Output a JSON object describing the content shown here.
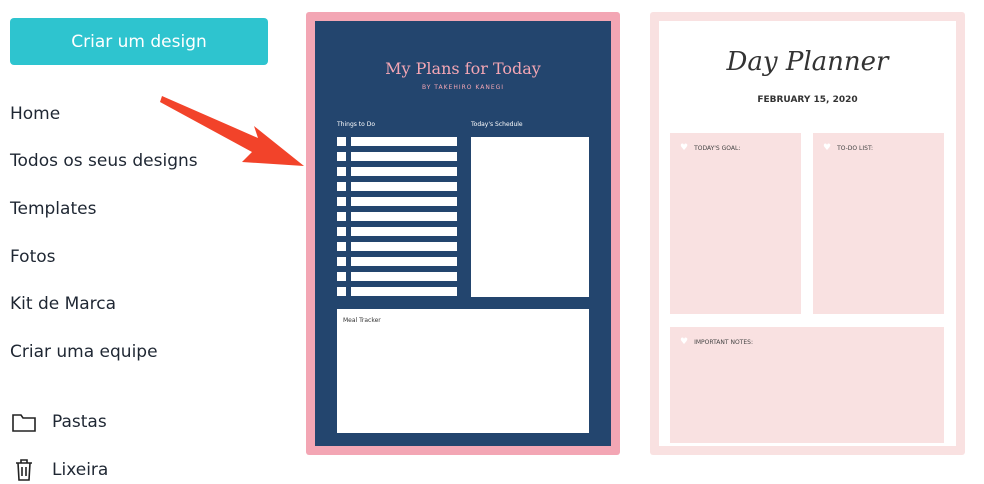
{
  "sidebar": {
    "create_button": "Criar um design",
    "nav": [
      "Home",
      "Todos os seus designs",
      "Templates",
      "Fotos",
      "Kit de Marca",
      "Criar uma equipe"
    ],
    "folders": "Pastas",
    "trash": "Lixeira"
  },
  "template1": {
    "title": "My Plans for Today",
    "subtitle": "BY TAKEHIRO KANEGI",
    "things_label": "Things to Do",
    "schedule_label": "Today's Schedule",
    "meal_label": "Meal Tracker",
    "colors": {
      "frame": "#f3a6b4",
      "background": "#23456e"
    }
  },
  "template2": {
    "title": "Day Planner",
    "date": "FEBRUARY 15, 2020",
    "goal_label": "TODAY'S GOAL:",
    "todo_label": "TO-DO LIST:",
    "notes_label": "IMPORTANT NOTES:",
    "colors": {
      "frame": "#f9e1e1"
    }
  },
  "colors": {
    "accent": "#2ec4cf",
    "arrow": "#f2432a"
  }
}
